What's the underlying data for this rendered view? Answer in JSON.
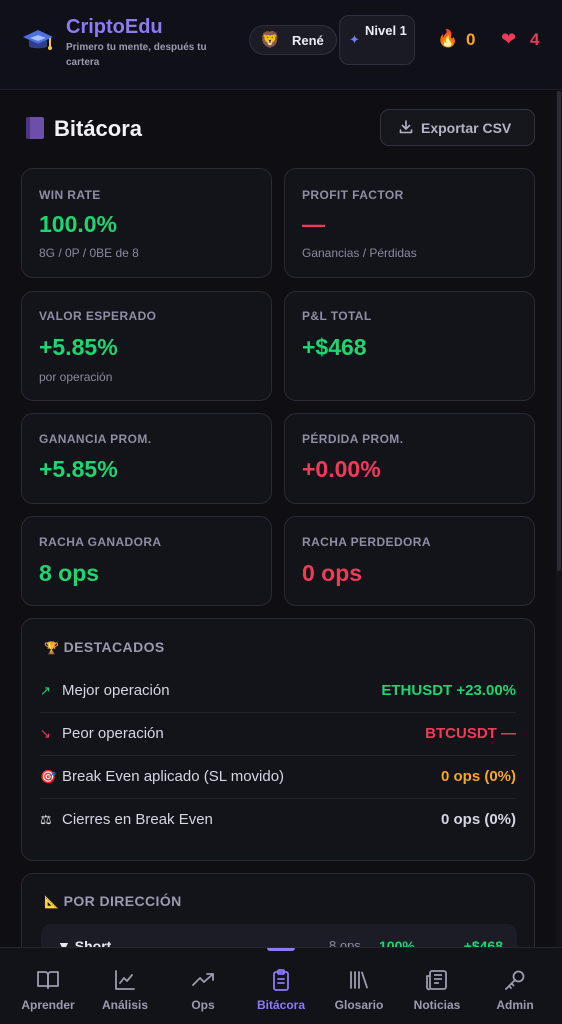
{
  "header": {
    "brand_name": "CriptoEdu",
    "brand_tagline": "Primero tu mente, después tu cartera",
    "user_name": "René",
    "level_label": "Nivel 1",
    "streak_value": "0",
    "lives_value": "4"
  },
  "page": {
    "title": "Bitácora",
    "export_label": "Exportar CSV"
  },
  "stats": [
    {
      "label": "WIN RATE",
      "value": "100.0%",
      "sub": "8G / 0P / 0BE de 8",
      "color": "green"
    },
    {
      "label": "PROFIT FACTOR",
      "value": "—",
      "sub": "Ganancias / Pérdidas",
      "color": "red"
    },
    {
      "label": "VALOR ESPERADO",
      "value": "+5.85%",
      "sub": "por operación",
      "color": "green"
    },
    {
      "label": "P&L TOTAL",
      "value": "+$468",
      "sub": "",
      "color": "green"
    },
    {
      "label": "GANANCIA PROM.",
      "value": "+5.85%",
      "sub": "",
      "color": "green"
    },
    {
      "label": "PÉRDIDA PROM.",
      "value": "+0.00%",
      "sub": "",
      "color": "red"
    },
    {
      "label": "RACHA GANADORA",
      "value": "8 ops",
      "sub": "",
      "color": "green"
    },
    {
      "label": "RACHA PERDEDORA",
      "value": "0 ops",
      "sub": "",
      "color": "red"
    }
  ],
  "highlights": {
    "title": "DESTACADOS",
    "rows": [
      {
        "icon": "trend-up-icon",
        "label": "Mejor operación",
        "value": "ETHUSDT +23.00%",
        "color": "#1ed56f"
      },
      {
        "icon": "trend-down-icon",
        "label": "Peor operación",
        "value": "BTCUSDT —",
        "color": "#f23a58"
      },
      {
        "icon": "target-icon",
        "label": "Break Even aplicado (SL movido)",
        "value": "0 ops (0%)",
        "color": "#f5a623"
      },
      {
        "icon": "scale-icon",
        "label": "Cierres en Break Even",
        "value": "0 ops (0%)",
        "color": "#d6d6e2"
      }
    ]
  },
  "direction": {
    "title": "POR DIRECCIÓN",
    "rows": [
      {
        "name": "▼ Short",
        "ops": "8 ops",
        "win_rate": "100%",
        "pnl": "+$468"
      }
    ]
  },
  "nav": {
    "active": "Bitácora",
    "items": [
      {
        "label": "Aprender",
        "icon": "book-open-icon"
      },
      {
        "label": "Análisis",
        "icon": "chart-line-icon"
      },
      {
        "label": "Ops",
        "icon": "trending-up-icon"
      },
      {
        "label": "Bitácora",
        "icon": "clipboard-icon"
      },
      {
        "label": "Glosario",
        "icon": "library-icon"
      },
      {
        "label": "Noticias",
        "icon": "newspaper-icon"
      },
      {
        "label": "Admin",
        "icon": "key-icon"
      }
    ]
  }
}
